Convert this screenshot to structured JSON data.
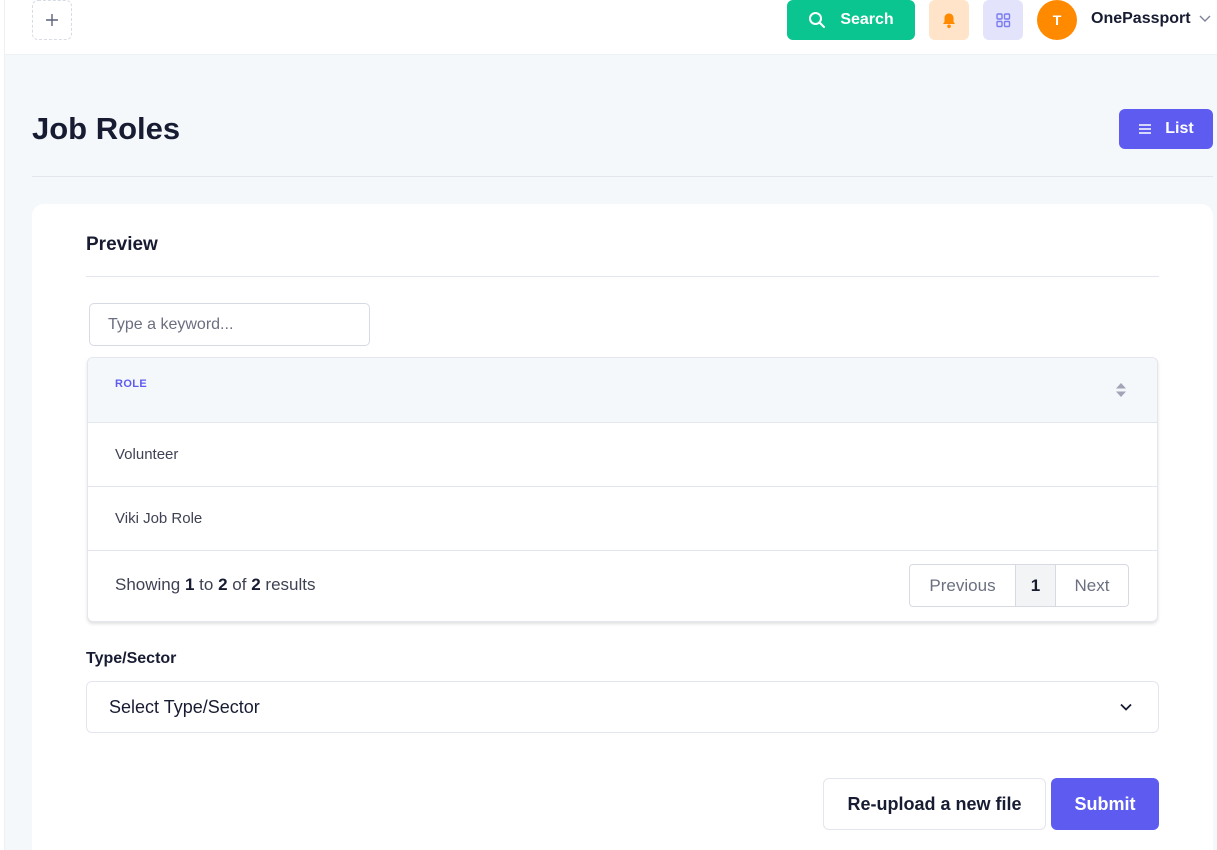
{
  "header": {
    "search_label": "Search",
    "avatar_initial": "T",
    "user_name": "OnePassport"
  },
  "toolbar": {
    "page_title": "Job Roles",
    "list_label": "List"
  },
  "card": {
    "title": "Preview",
    "search_placeholder": "Type a keyword...",
    "table": {
      "column_header": "ROLE",
      "rows": [
        "Volunteer",
        "Viki Job Role"
      ]
    },
    "pagination": {
      "showing": "Showing",
      "from": "1",
      "to_word": "to",
      "to": "2",
      "of_word": "of",
      "total": "2",
      "results_word": "results",
      "previous_label": "Previous",
      "current_page": "1",
      "next_label": "Next"
    },
    "type_sector_label": "Type/Sector",
    "type_sector_value": "Select Type/Sector",
    "reupload_label": "Re-upload a new file",
    "submit_label": "Submit"
  },
  "colors": {
    "accent": "#5e5cf0",
    "search_green": "#0bc590",
    "avatar_orange": "#ff8a00"
  },
  "icons": {
    "add": "plus-icon",
    "search": "search-icon",
    "notifications": "bell-icon",
    "apps": "grid-icon",
    "user_menu": "chevron-down-icon",
    "list": "menu-icon",
    "sort": "sort-icon",
    "select": "chevron-down-icon"
  }
}
